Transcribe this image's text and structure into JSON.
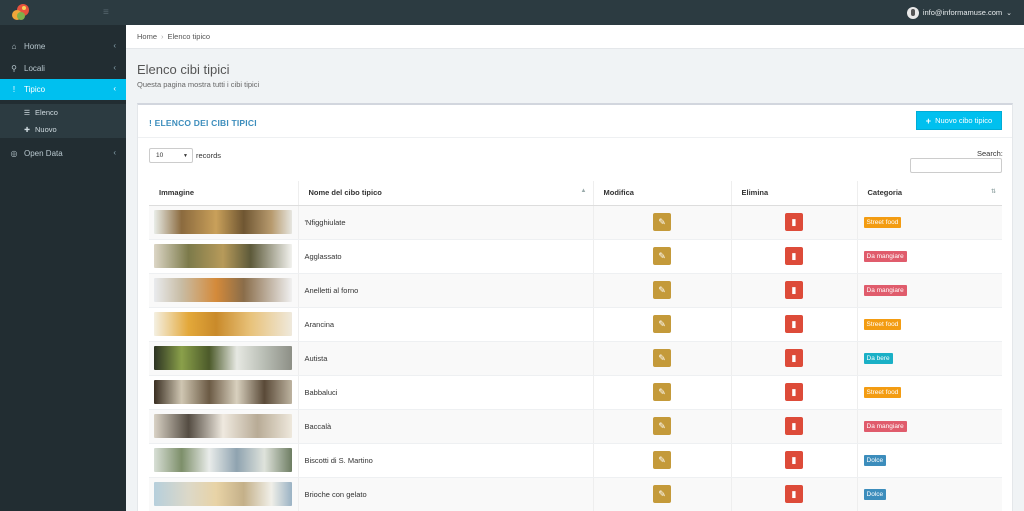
{
  "header": {
    "user_email": "info@informamuse.com",
    "colors": {
      "bar": "#2c3b41"
    }
  },
  "sidebar": {
    "items": [
      {
        "label": "Home",
        "icon": "home-icon"
      },
      {
        "label": "Locali",
        "icon": "map-marker-icon"
      },
      {
        "label": "Tipico",
        "icon": "thermometer-icon",
        "active": true
      },
      {
        "label": "Open Data",
        "icon": "globe-icon"
      }
    ],
    "sub_items": [
      {
        "label": "Elenco",
        "icon": "list-icon"
      },
      {
        "label": "Nuovo",
        "icon": "plus-icon"
      }
    ]
  },
  "breadcrumb": {
    "home": "Home",
    "current": "Elenco tipico"
  },
  "page": {
    "title": "Elenco cibi tipici",
    "subtitle": "Questa pagina mostra tutti i cibi tipici"
  },
  "panel": {
    "title": "ELENCO DEI CIBI TIPICI",
    "new_button": "Nuovo cibo tipico",
    "length_value": "10",
    "length_suffix": "records",
    "search_label": "Search:"
  },
  "table": {
    "columns": [
      "Immagine",
      "Nome del cibo tipico",
      "Modifica",
      "Elimina",
      "Categoria"
    ],
    "rows": [
      {
        "name": "'Nfigghiulate",
        "category": "Street food",
        "cat_color": "#f39c12"
      },
      {
        "name": "Agglassato",
        "category": "Da mangiare",
        "cat_color": "#e05c6c"
      },
      {
        "name": "Anelletti al forno",
        "category": "Da mangiare",
        "cat_color": "#e05c6c"
      },
      {
        "name": "Arancina",
        "category": "Street food",
        "cat_color": "#f39c12"
      },
      {
        "name": "Autista",
        "category": "Da bere",
        "cat_color": "#1ab0c6"
      },
      {
        "name": "Babbaluci",
        "category": "Street food",
        "cat_color": "#f39c12"
      },
      {
        "name": "Baccalà",
        "category": "Da mangiare",
        "cat_color": "#e05c6c"
      },
      {
        "name": "Biscotti di S. Martino",
        "category": "Dolce",
        "cat_color": "#3c8dbc"
      },
      {
        "name": "Brioche con gelato",
        "category": "Dolce",
        "cat_color": "#3c8dbc"
      }
    ]
  }
}
